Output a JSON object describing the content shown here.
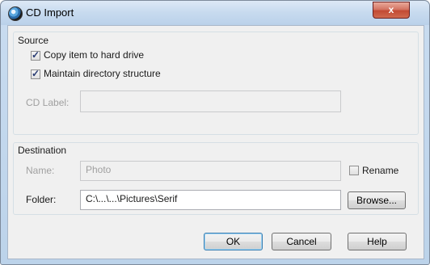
{
  "window": {
    "title": "CD Import",
    "close_glyph": "x"
  },
  "source": {
    "title": "Source",
    "copy_item": {
      "label": "Copy item to hard drive",
      "checked": true
    },
    "maintain_dir": {
      "label": "Maintain directory structure",
      "checked": true
    },
    "cd_label": {
      "label": "CD Label:",
      "value": ""
    }
  },
  "destination": {
    "title": "Destination",
    "name": {
      "label": "Name:",
      "value": "Photo"
    },
    "rename": {
      "label": "Rename",
      "checked": false
    },
    "folder": {
      "label": "Folder:",
      "value": "C:\\...\\...\\Pictures\\Serif"
    },
    "browse_label": "Browse..."
  },
  "buttons": {
    "ok": "OK",
    "cancel": "Cancel",
    "help": "Help"
  },
  "check_glyph": "✓"
}
